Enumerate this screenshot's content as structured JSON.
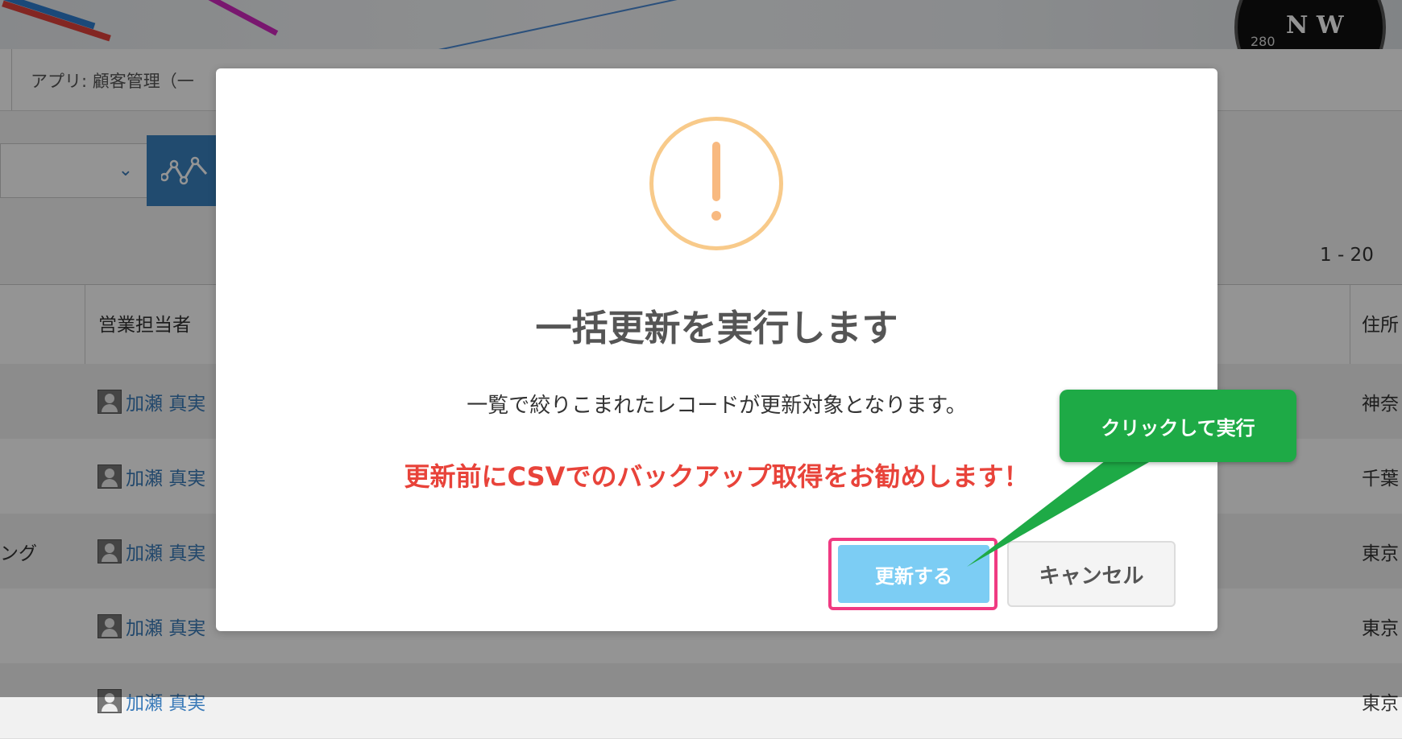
{
  "breadcrumb": "アプリ: 顧客管理（一",
  "page_count": "1 - 20",
  "table": {
    "headers": {
      "sales_rep": "営業担当者",
      "address": "住所"
    },
    "rows": [
      {
        "left": "",
        "rep": "加瀬 真実",
        "address": "神奈"
      },
      {
        "left": "",
        "rep": "加瀬 真実",
        "address": "千葉"
      },
      {
        "left": "ング",
        "rep": "加瀬 真実",
        "address": "東京"
      },
      {
        "left": "",
        "rep": "加瀬 真実",
        "address": "東京"
      },
      {
        "left": "",
        "rep": "加瀬 真実",
        "address": "東京"
      }
    ]
  },
  "modal": {
    "icon": "exclamation-icon",
    "title": "一括更新を実行します",
    "description": "一覧で絞りこまれたレコードが更新対象となります。",
    "warning": "更新前にCSVでのバックアップ取得をお勧めします！",
    "update_button": "更新する",
    "cancel_button": "キャンセル"
  },
  "callout": {
    "text": "クリックして実行",
    "color": "#1eaa46"
  },
  "colors": {
    "warning_text": "#e8433a",
    "update_button": "#7ccdf4",
    "highlight_border": "#f03a82",
    "icon_ring": "#f8ca8a"
  }
}
